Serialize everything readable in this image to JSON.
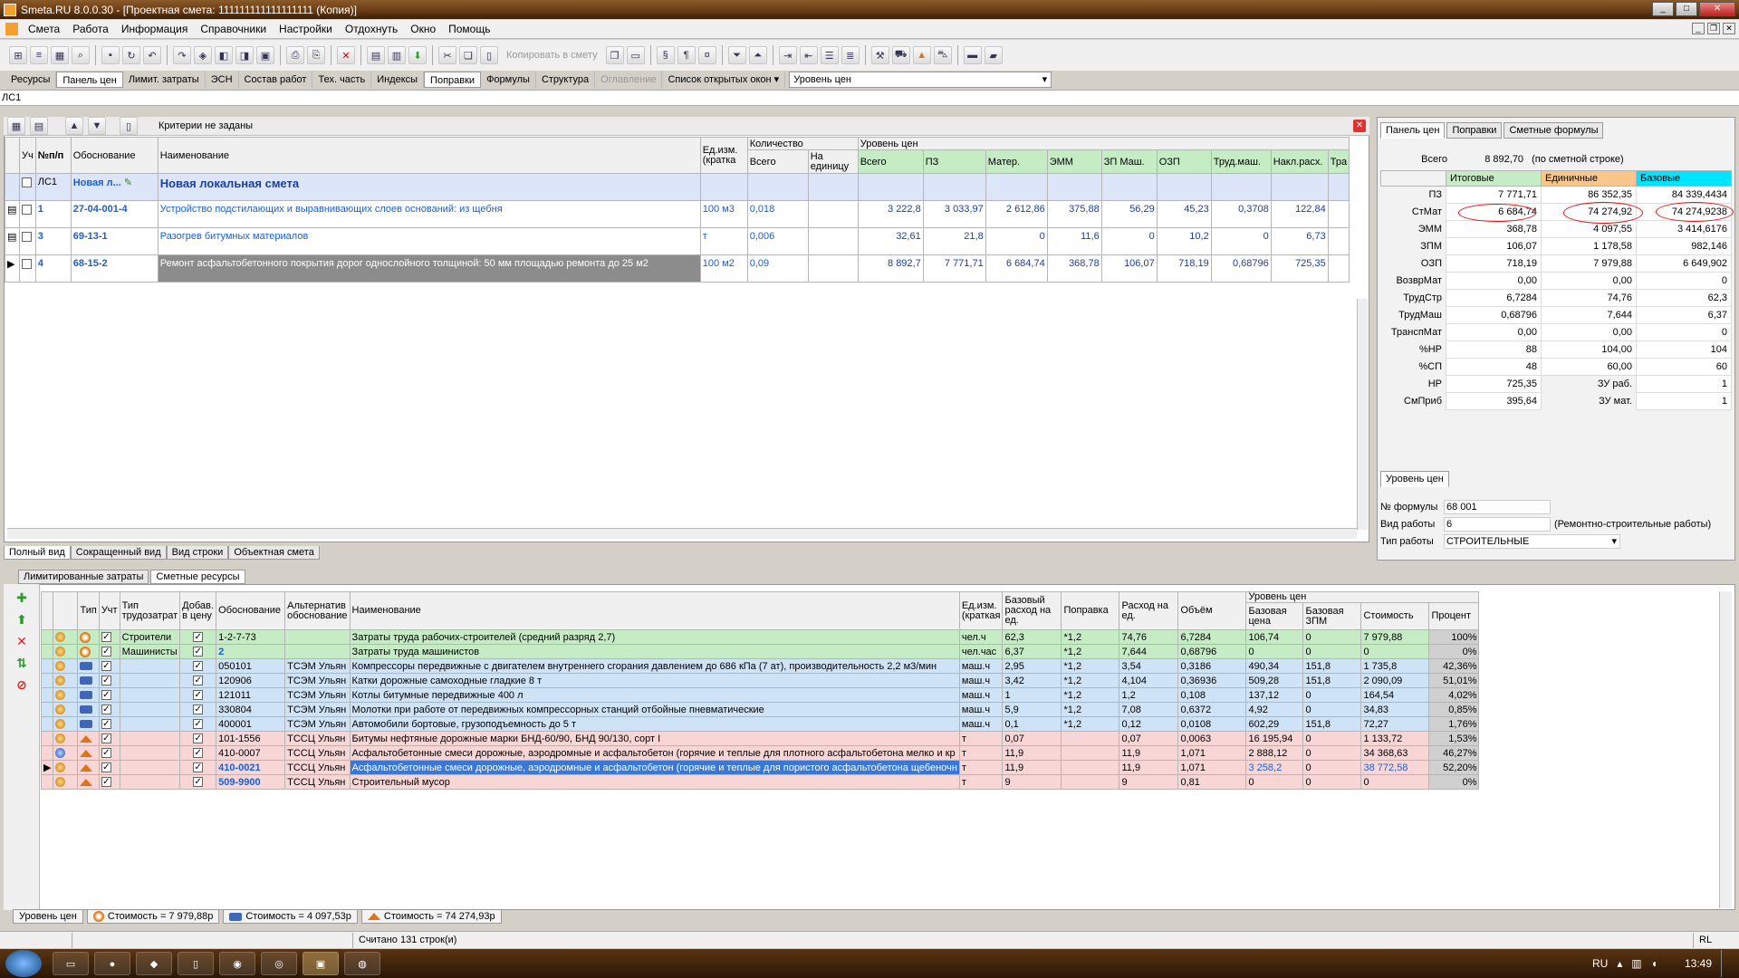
{
  "window": {
    "title": "Smeta.RU  8.0.0.30  - [Проектная смета: 111111111111111111 (Копия)]"
  },
  "menu": [
    "Смета",
    "Работа",
    "Информация",
    "Справочники",
    "Настройки",
    "Отдохнуть",
    "Окно",
    "Помощь"
  ],
  "toolbar": {
    "copy_label": "Копировать в смету"
  },
  "toolbar2": {
    "items": [
      "Ресурсы",
      "Панель цен",
      "Лимит. затраты",
      "ЭСН",
      "Состав работ",
      "Тех. часть",
      "Индексы",
      "Поправки",
      "Формулы",
      "Структура",
      "Оглавление",
      "Список открытых окон ▾"
    ],
    "level_label": "Уровень цен"
  },
  "address": "ЛС1",
  "filter": {
    "label": "Критерии не заданы"
  },
  "grid": {
    "headers": {
      "flag": "Уч",
      "num": "№п/п",
      "basis": "Обоснование",
      "name": "Наименование",
      "unit": "Ед.изм. (кратка",
      "qty": "Количество",
      "qty_total": "Всего",
      "qty_unit": "На единицу",
      "price_level": "Уровень цен",
      "total": "Всего",
      "pz": "ПЗ",
      "mater": "Матер.",
      "emm": "ЭММ",
      "zpm": "ЗП Маш.",
      "ozp": "ОЗП",
      "trud": "Труд.маш.",
      "nakl": "Накл.расх.",
      "tr": "Тра"
    },
    "header_row": {
      "num": "ЛС1",
      "basis": "Новая л...",
      "name": "Новая локальная смета"
    },
    "rows": [
      {
        "num": "1",
        "basis": "27-04-001-4",
        "name": "Устройство подстилающих и выравнивающих слоев оснований: из щебня",
        "unit": "100 м3",
        "qty": "0,018",
        "total": "3 222,8",
        "pz": "3 033,97",
        "mater": "2 612,86",
        "emm": "375,88",
        "zpm": "56,29",
        "ozp": "45,23",
        "trud": "0,3708",
        "nakl": "122,84"
      },
      {
        "num": "3",
        "basis": "69-13-1",
        "name": "Разогрев битумных материалов",
        "unit": "т",
        "qty": "0,006",
        "total": "32,61",
        "pz": "21,8",
        "mater": "0",
        "emm": "11,6",
        "zpm": "0",
        "ozp": "10,2",
        "trud": "0",
        "nakl": "6,73"
      },
      {
        "num": "4",
        "basis": "68-15-2",
        "name": "Ремонт асфальтобетонного покрытия дорог однослойного толщиной: 50 мм площадью ремонта до 25 м2",
        "unit": "100 м2",
        "qty": "0,09",
        "total": "8 892,7",
        "pz": "7 771,71",
        "mater": "6 684,74",
        "emm": "368,78",
        "zpm": "106,07",
        "ozp": "718,19",
        "trud": "0,68796",
        "nakl": "725,35"
      }
    ]
  },
  "view_tabs": [
    "Полный вид",
    "Сокращенный вид",
    "Вид строки",
    "Объектная смета"
  ],
  "right_panel": {
    "tabs": [
      "Панель цен",
      "Поправки",
      "Сметные формулы"
    ],
    "total_label": "Всего",
    "total_value": "8 892,70",
    "total_note": "(по сметной строке)",
    "columns": [
      "Итоговые",
      "Единичные",
      "Базовые"
    ],
    "rows": [
      {
        "label": "ПЗ",
        "a": "7 771,71",
        "b": "86 352,35",
        "c": "84 339,4434"
      },
      {
        "label": "СтМат",
        "a": "6 684,74",
        "b": "74 274,92",
        "c": "74 274,9238"
      },
      {
        "label": "ЭММ",
        "a": "368,78",
        "b": "4 097,55",
        "c": "3 414,6176"
      },
      {
        "label": "ЗПМ",
        "a": "106,07",
        "b": "1 178,58",
        "c": "982,146"
      },
      {
        "label": "ОЗП",
        "a": "718,19",
        "b": "7 979,88",
        "c": "6 649,902"
      },
      {
        "label": "ВозврМат",
        "a": "0,00",
        "b": "0,00",
        "c": "0"
      },
      {
        "label": "ТрудСтр",
        "a": "6,7284",
        "b": "74,76",
        "c": "62,3"
      },
      {
        "label": "ТрудМаш",
        "a": "0,68796",
        "b": "7,644",
        "c": "6,37"
      },
      {
        "label": "ТранспМат",
        "a": "0,00",
        "b": "0,00",
        "c": "0"
      },
      {
        "label": "%НР",
        "a": "88",
        "b": "104,00",
        "c": "104"
      },
      {
        "label": "%СП",
        "a": "48",
        "b": "60,00",
        "c": "60"
      },
      {
        "label": "НР",
        "a": "725,35",
        "b": "ЗУ раб.",
        "c": "1"
      },
      {
        "label": "СмПриб",
        "a": "395,64",
        "b": "ЗУ мат.",
        "c": "1"
      }
    ],
    "level_tab": "Уровень цен",
    "formula_label": "№ формулы",
    "formula_value": "68 001",
    "work_kind_label": "Вид работы",
    "work_kind_value": "6",
    "work_kind_note": "(Ремонтно-строительные работы)",
    "work_type_label": "Тип работы",
    "work_type_value": "СТРОИТЕЛЬНЫЕ"
  },
  "bottom_tabs": [
    "Лимитированные затраты",
    "Сметные ресурсы"
  ],
  "resources": {
    "headers": {
      "type": "Тип",
      "flag": "Учт",
      "labor_type": "Тип трудозатрат",
      "add_price": "Добав. в цену",
      "basis": "Обоснование",
      "alt": "Альтернатив обоснование",
      "name": "Наименование",
      "unit": "Ед.изм. (краткая",
      "base_rate": "Базовый расход на ед.",
      "corr": "Поправка",
      "rate": "Расход на ед.",
      "volume": "Объём",
      "level": "Уровень цен",
      "base_price": "Базовая цена",
      "base_zpm": "Базовая ЗПМ",
      "cost": "Стоимость",
      "pct": "Процент"
    },
    "rows": [
      {
        "cls": "tr-work",
        "icon": "w",
        "labor": "Строители",
        "basis": "1-2-7-73",
        "alt": "",
        "name": "Затраты труда рабочих-строителей (средний разряд 2,7)",
        "unit": "чел.ч",
        "base_rate": "62,3",
        "corr": "*1,2",
        "rate": "74,76",
        "volume": "6,7284",
        "base_price": "106,74",
        "base_zpm": "0",
        "cost": "7 979,88",
        "pct": "100%"
      },
      {
        "cls": "tr-work",
        "icon": "w",
        "labor": "Машинисты",
        "basis": "2",
        "alt": "",
        "name": "Затраты труда машинистов",
        "unit": "чел.час",
        "base_rate": "6,37",
        "corr": "*1,2",
        "rate": "7,644",
        "volume": "0,68796",
        "base_price": "0",
        "base_zpm": "0",
        "cost": "0",
        "pct": "0%"
      },
      {
        "cls": "tr-mach",
        "icon": "m",
        "labor": "",
        "basis": "050101",
        "alt": "ТСЭМ Ульян",
        "name": "Компрессоры передвижные с двигателем внутреннего сгорания давлением до 686 кПа (7 ат), производительность 2,2 м3/мин",
        "unit": "маш.ч",
        "base_rate": "2,95",
        "corr": "*1,2",
        "rate": "3,54",
        "volume": "0,3186",
        "base_price": "490,34",
        "base_zpm": "151,8",
        "cost": "1 735,8",
        "pct": "42,36%"
      },
      {
        "cls": "tr-mach",
        "icon": "m",
        "labor": "",
        "basis": "120906",
        "alt": "ТСЭМ Ульян",
        "name": "Катки дорожные самоходные гладкие 8 т",
        "unit": "маш.ч",
        "base_rate": "3,42",
        "corr": "*1,2",
        "rate": "4,104",
        "volume": "0,36936",
        "base_price": "509,28",
        "base_zpm": "151,8",
        "cost": "2 090,09",
        "pct": "51,01%"
      },
      {
        "cls": "tr-mach",
        "icon": "m",
        "labor": "",
        "basis": "121011",
        "alt": "ТСЭМ Ульян",
        "name": "Котлы битумные передвижные 400 л",
        "unit": "маш.ч",
        "base_rate": "1",
        "corr": "*1,2",
        "rate": "1,2",
        "volume": "0,108",
        "base_price": "137,12",
        "base_zpm": "0",
        "cost": "164,54",
        "pct": "4,02%"
      },
      {
        "cls": "tr-mach",
        "icon": "m",
        "labor": "",
        "basis": "330804",
        "alt": "ТСЭМ Ульян",
        "name": "Молотки при работе от передвижных компрессорных станций отбойные пневматические",
        "unit": "маш.ч",
        "base_rate": "5,9",
        "corr": "*1,2",
        "rate": "7,08",
        "volume": "0,6372",
        "base_price": "4,92",
        "base_zpm": "0",
        "cost": "34,83",
        "pct": "0,85%"
      },
      {
        "cls": "tr-mach",
        "icon": "m",
        "labor": "",
        "basis": "400001",
        "alt": "ТСЭМ Ульян",
        "name": "Автомобили бортовые, грузоподъемность до 5 т",
        "unit": "маш.ч",
        "base_rate": "0,1",
        "corr": "*1,2",
        "rate": "0,12",
        "volume": "0,0108",
        "base_price": "602,29",
        "base_zpm": "151,8",
        "cost": "72,27",
        "pct": "1,76%"
      },
      {
        "cls": "tr-mat",
        "icon": "t",
        "labor": "",
        "basis": "101-1556",
        "alt": "ТССЦ Ульян",
        "name": "Битумы нефтяные дорожные марки БНД-60/90, БНД 90/130, сорт I",
        "unit": "т",
        "base_rate": "0,07",
        "corr": "",
        "rate": "0,07",
        "volume": "0,0063",
        "base_price": "16 195,94",
        "base_zpm": "0",
        "cost": "1 133,72",
        "pct": "1,53%"
      },
      {
        "cls": "tr-mat",
        "icon": "t",
        "labor": "",
        "basis": "410-0007",
        "alt": "ТССЦ Ульян",
        "name": "Асфальтобетонные смеси дорожные, аэродромные и асфальтобетон (горячие и теплые для плотного асфальтобетона мелко и кр",
        "unit": "т",
        "base_rate": "11,9",
        "corr": "",
        "rate": "11,9",
        "volume": "1,071",
        "base_price": "2 888,12",
        "base_zpm": "0",
        "cost": "34 368,63",
        "pct": "46,27%"
      },
      {
        "cls": "tr-mat sel",
        "icon": "t",
        "labor": "",
        "basis": "410-0021",
        "alt": "ТССЦ Ульян",
        "name": "Асфальтобетонные смеси дорожные, аэродромные и асфальтобетон (горячие и теплые для пористого асфальтобетона щебеночн",
        "unit": "т",
        "base_rate": "11,9",
        "corr": "",
        "rate": "11,9",
        "volume": "1,071",
        "base_price": "3 258,2",
        "base_zpm": "0",
        "cost": "38 772,58",
        "pct": "52,20%"
      },
      {
        "cls": "tr-mat",
        "icon": "t",
        "labor": "",
        "basis": "509-9900",
        "alt": "ТССЦ Ульян",
        "name": "Строительный мусор",
        "unit": "т",
        "base_rate": "9",
        "corr": "",
        "rate": "9",
        "volume": "0,81",
        "base_price": "0",
        "base_zpm": "0",
        "cost": "0",
        "pct": "0%"
      }
    ]
  },
  "bottom_status": {
    "level": "Уровень цен",
    "c1": "Стоимость = 7 979,88р",
    "c2": "Стоимость = 4 097,53р",
    "c3": "Стоимость = 74 274,93р"
  },
  "status": {
    "rows": "Считано 131 строк(и)",
    "lang": "RL"
  },
  "taskbar": {
    "lang": "RU",
    "clock": "13:49"
  }
}
